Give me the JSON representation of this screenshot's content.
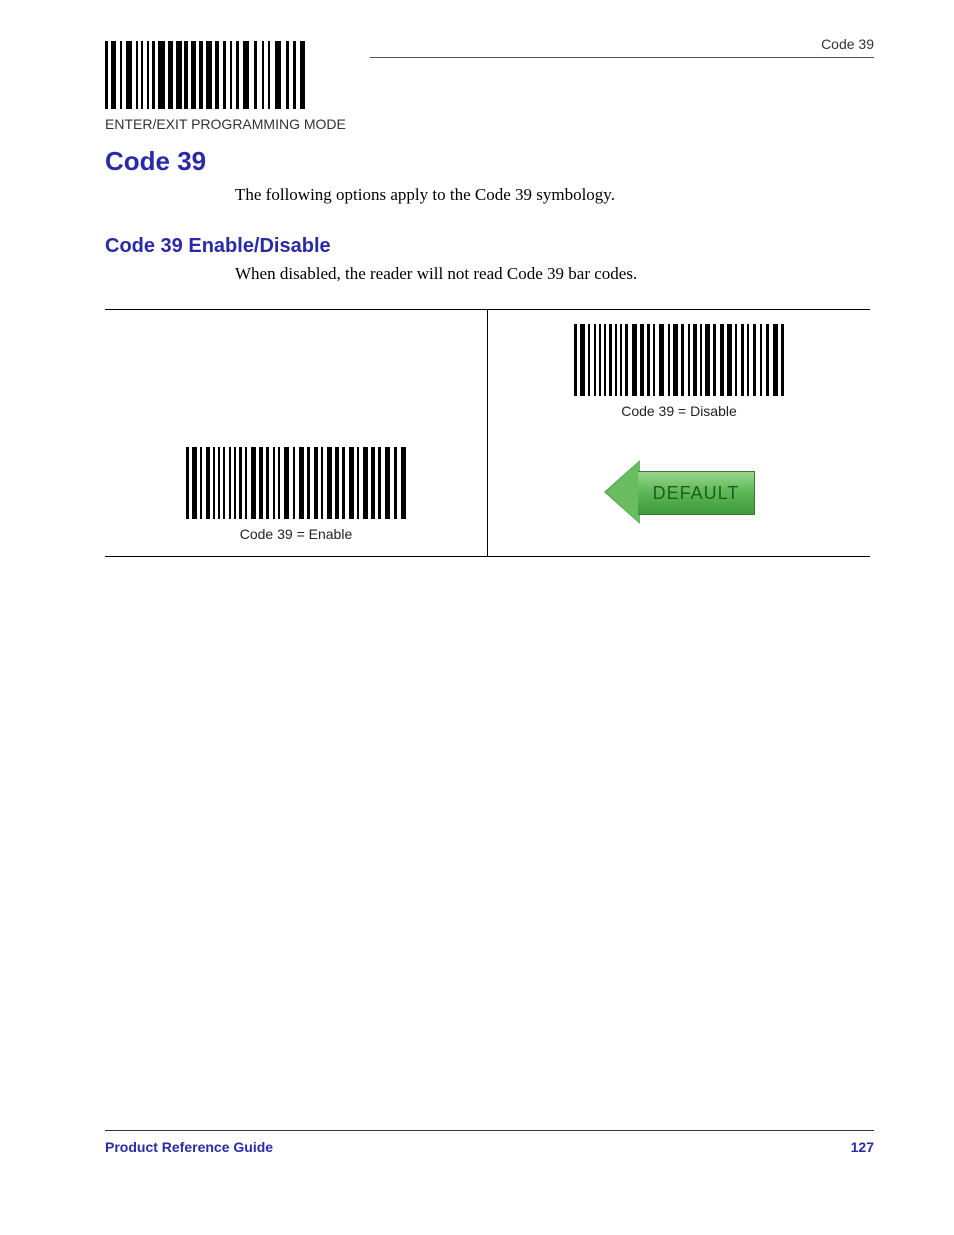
{
  "header": {
    "running_head": "Code 39",
    "prog_mode_label": "ENTER/EXIT PROGRAMMING MODE"
  },
  "section": {
    "title": "Code 39",
    "intro": "The following options apply to the Code 39 symbology."
  },
  "subsection": {
    "title": "Code 39 Enable/Disable",
    "intro": "When disabled, the reader will not read Code 39 bar codes."
  },
  "options": {
    "disable_label": "Code 39 = Disable",
    "enable_label": "Code 39 = Enable",
    "default_badge": "DEFAULT"
  },
  "footer": {
    "guide": "Product Reference Guide",
    "page": "127"
  }
}
